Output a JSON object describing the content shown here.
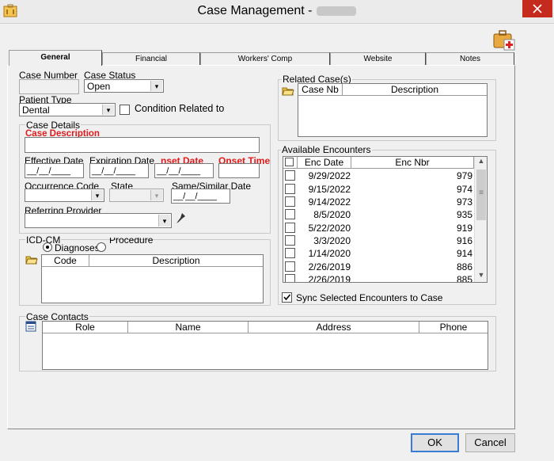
{
  "window": {
    "title": "Case Management -",
    "buttons": {
      "ok": "OK",
      "cancel": "Cancel"
    }
  },
  "tabs": [
    "General",
    "Financial",
    "Workers' Comp",
    "Website",
    "Notes"
  ],
  "general": {
    "case_number_label": "Case Number",
    "case_status_label": "Case Status",
    "case_status_value": "Open",
    "patient_type_label": "Patient Type",
    "patient_type_value": "Dental",
    "condition_label": "Condition Related to",
    "case_details": {
      "title": "Case Details",
      "description_label": "Case Description",
      "effective_date_label": "Effective Date",
      "expiration_date_label": "Expiration Date",
      "onset_date_label": "nset Date",
      "onset_time_label": "Onset Time",
      "occurrence_code_label": "Occurrence Code",
      "state_label": "State",
      "same_similar_label": "Same/Similar Date",
      "referring_provider_label": "Referring Provider",
      "date_mask": "__/__/____"
    },
    "icd": {
      "title": "ICD-CM",
      "diagnoses_label": "Diagnoses",
      "procedure_label": "Procedure",
      "columns": [
        "Code",
        "Description"
      ]
    },
    "related_cases": {
      "title": "Related Case(s)",
      "columns": [
        "Case Nb",
        "Description"
      ]
    },
    "available_encounters": {
      "title": "Available Encounters",
      "columns": [
        "Enc Date",
        "Enc Nbr"
      ],
      "rows": [
        {
          "date": "9/29/2022",
          "nbr": "979"
        },
        {
          "date": "9/15/2022",
          "nbr": "974"
        },
        {
          "date": "9/14/2022",
          "nbr": "973"
        },
        {
          "date": "8/5/2020",
          "nbr": "935"
        },
        {
          "date": "5/22/2020",
          "nbr": "919"
        },
        {
          "date": "3/3/2020",
          "nbr": "916"
        },
        {
          "date": "1/14/2020",
          "nbr": "914"
        },
        {
          "date": "2/26/2019",
          "nbr": "886"
        },
        {
          "date": "2/26/2019",
          "nbr": "885"
        }
      ],
      "sync_label": "Sync Selected Encounters to Case"
    },
    "case_contacts": {
      "title": "Case Contacts",
      "columns": [
        "Role",
        "Name",
        "Address",
        "Phone"
      ]
    }
  }
}
